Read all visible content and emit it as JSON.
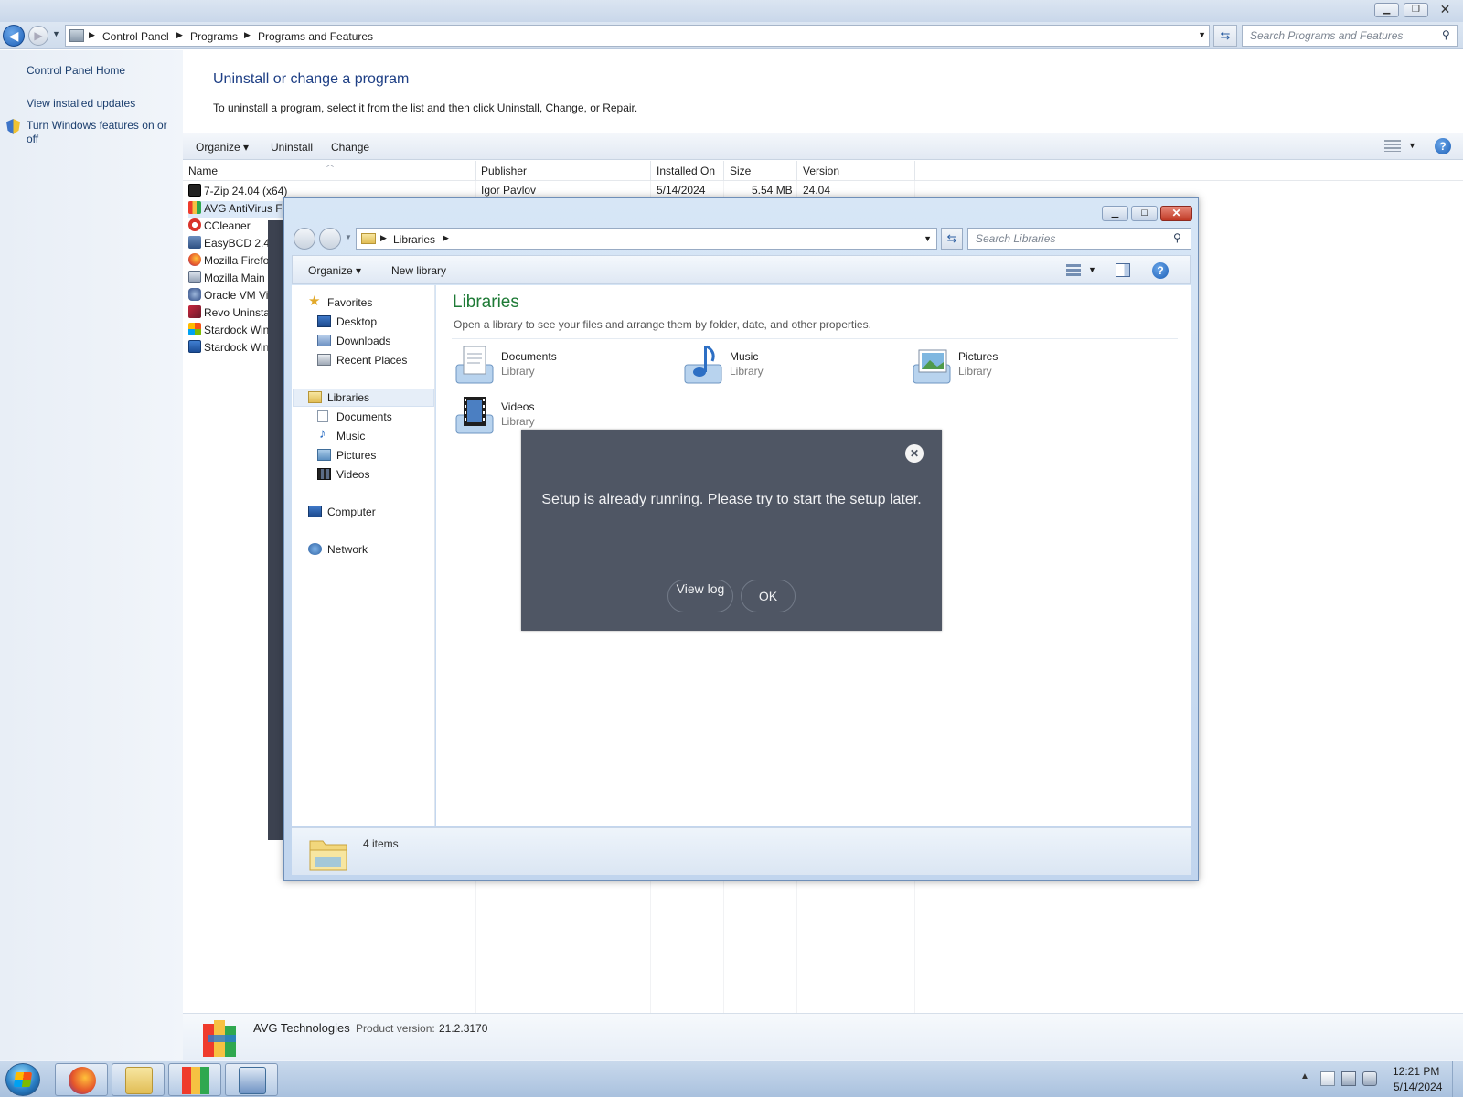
{
  "control_panel": {
    "breadcrumb": [
      "Control Panel",
      "Programs",
      "Programs and Features"
    ],
    "search_placeholder": "Search Programs and Features",
    "sidebar": {
      "home": "Control Panel Home",
      "updates": "View installed updates",
      "features": "Turn Windows features on or off"
    },
    "heading": "Uninstall or change a program",
    "subtext": "To uninstall a program, select it from the list and then click Uninstall, Change, or Repair.",
    "toolbar": {
      "organize": "Organize",
      "uninstall": "Uninstall",
      "change": "Change"
    },
    "columns": {
      "name": "Name",
      "publisher": "Publisher",
      "installed_on": "Installed On",
      "size": "Size",
      "version": "Version"
    },
    "programs": [
      {
        "name": "7-Zip 24.04 (x64)",
        "publisher": "Igor Pavlov",
        "installed_on": "5/14/2024",
        "size": "5.54 MB",
        "version": "24.04",
        "icon": "7zip-icon"
      },
      {
        "name": "AVG AntiVirus F",
        "icon": "avg-icon"
      },
      {
        "name": "CCleaner",
        "icon": "ccleaner-icon"
      },
      {
        "name": "EasyBCD 2.4",
        "icon": "easybcd-icon"
      },
      {
        "name": "Mozilla Firefo",
        "icon": "firefox-icon"
      },
      {
        "name": "Mozilla Main",
        "icon": "mozilla-maintenance-icon"
      },
      {
        "name": "Oracle VM Vi",
        "icon": "virtualbox-icon"
      },
      {
        "name": "Revo Uninsta",
        "icon": "revo-icon"
      },
      {
        "name": "Stardock Win",
        "icon": "stardock-icon"
      },
      {
        "name": "Stardock Win",
        "icon": "stardock-icon"
      }
    ],
    "details": {
      "company": "AVG Technologies",
      "version_label": "Product version:",
      "version": "21.2.3170"
    }
  },
  "libraries_window": {
    "address": "Libraries",
    "search_placeholder": "Search Libraries",
    "toolbar": {
      "organize": "Organize",
      "new_library": "New library"
    },
    "nav": {
      "favorites": "Favorites",
      "desktop": "Desktop",
      "downloads": "Downloads",
      "recent_places": "Recent Places",
      "libraries": "Libraries",
      "documents": "Documents",
      "music": "Music",
      "pictures": "Pictures",
      "videos": "Videos",
      "computer": "Computer",
      "network": "Network"
    },
    "title": "Libraries",
    "description": "Open a library to see your files and arrange them by folder, date, and other properties.",
    "libraries": [
      {
        "name": "Documents",
        "type": "Library"
      },
      {
        "name": "Music",
        "type": "Library"
      },
      {
        "name": "Pictures",
        "type": "Library"
      },
      {
        "name": "Videos",
        "type": "Library"
      }
    ],
    "status": "4 items"
  },
  "avg_dialog": {
    "message": "Setup is already running. Please try to start the setup later.",
    "view_log": "View log",
    "ok": "OK"
  },
  "taskbar": {
    "time": "12:21 PM",
    "date": "5/14/2024"
  },
  "colors": {
    "dialog_bg": "#4f5664",
    "library_title": "#1e7a36",
    "heading_blue": "#1e3f85"
  }
}
